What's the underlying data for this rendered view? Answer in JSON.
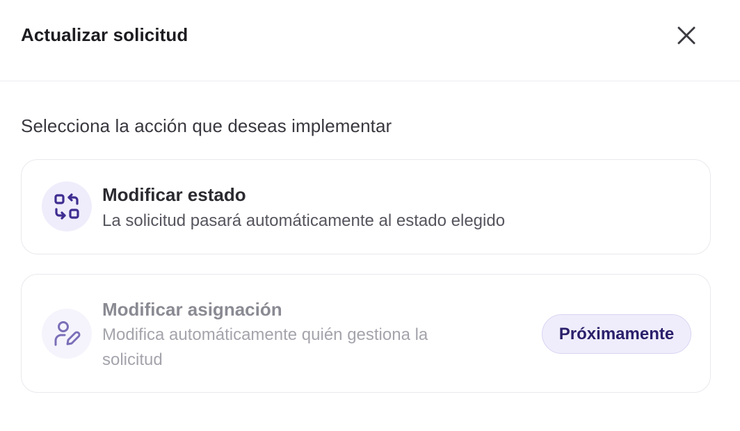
{
  "dialog": {
    "title": "Actualizar solicitud",
    "close_icon": "close-icon"
  },
  "prompt": "Selecciona la acción que deseas implementar",
  "options": [
    {
      "title": "Modificar estado",
      "description": "La solicitud pasará automáticamente al estado elegido",
      "icon": "swap-status-icon",
      "enabled": true
    },
    {
      "title": "Modificar asignación",
      "description": "Modifica automáticamente quién gestiona la solicitud",
      "icon": "user-edit-icon",
      "enabled": false,
      "badge": "Próximamente"
    }
  ],
  "colors": {
    "accent": "#3f2d91",
    "accent_bg": "#efedfb",
    "badge_text": "#2a1f6b",
    "disabled_text": "#8a8a93"
  }
}
